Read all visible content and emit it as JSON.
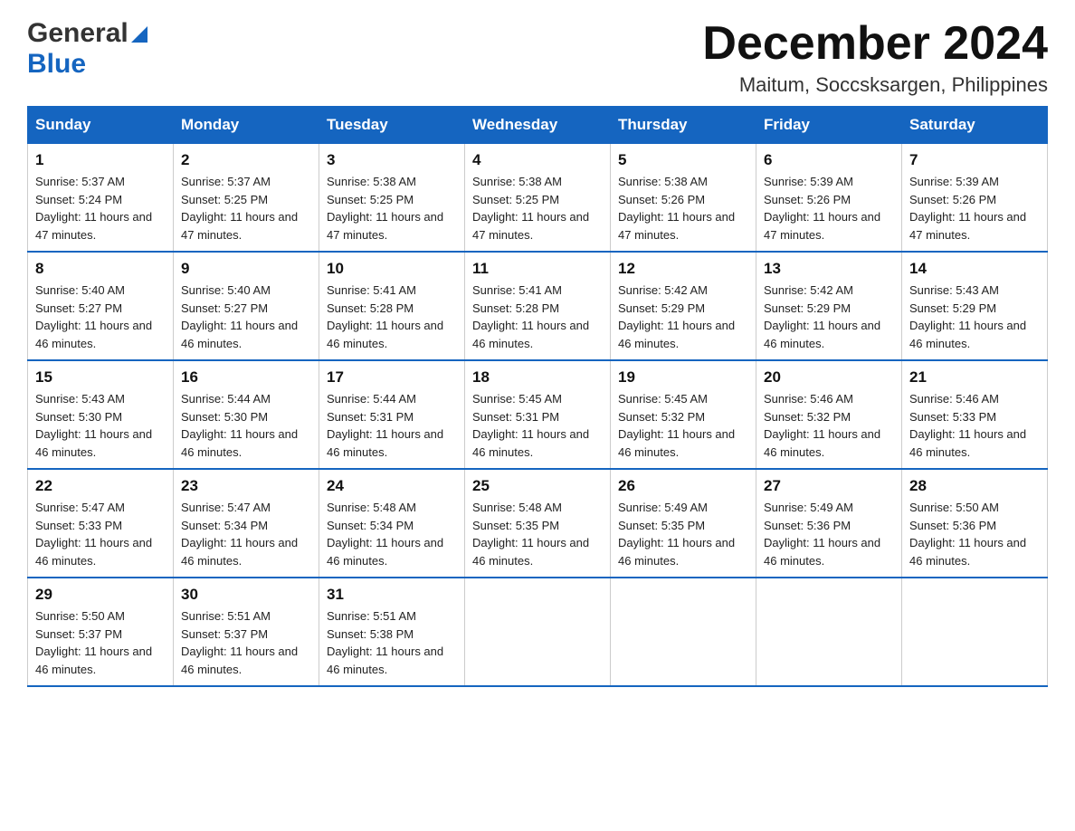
{
  "header": {
    "month_year": "December 2024",
    "location": "Maitum, Soccsksargen, Philippines"
  },
  "logo": {
    "general": "General",
    "blue": "Blue"
  },
  "days_of_week": [
    "Sunday",
    "Monday",
    "Tuesday",
    "Wednesday",
    "Thursday",
    "Friday",
    "Saturday"
  ],
  "weeks": [
    [
      {
        "day": "1",
        "sunrise": "5:37 AM",
        "sunset": "5:24 PM",
        "daylight": "11 hours and 47 minutes."
      },
      {
        "day": "2",
        "sunrise": "5:37 AM",
        "sunset": "5:25 PM",
        "daylight": "11 hours and 47 minutes."
      },
      {
        "day": "3",
        "sunrise": "5:38 AM",
        "sunset": "5:25 PM",
        "daylight": "11 hours and 47 minutes."
      },
      {
        "day": "4",
        "sunrise": "5:38 AM",
        "sunset": "5:25 PM",
        "daylight": "11 hours and 47 minutes."
      },
      {
        "day": "5",
        "sunrise": "5:38 AM",
        "sunset": "5:26 PM",
        "daylight": "11 hours and 47 minutes."
      },
      {
        "day": "6",
        "sunrise": "5:39 AM",
        "sunset": "5:26 PM",
        "daylight": "11 hours and 47 minutes."
      },
      {
        "day": "7",
        "sunrise": "5:39 AM",
        "sunset": "5:26 PM",
        "daylight": "11 hours and 47 minutes."
      }
    ],
    [
      {
        "day": "8",
        "sunrise": "5:40 AM",
        "sunset": "5:27 PM",
        "daylight": "11 hours and 46 minutes."
      },
      {
        "day": "9",
        "sunrise": "5:40 AM",
        "sunset": "5:27 PM",
        "daylight": "11 hours and 46 minutes."
      },
      {
        "day": "10",
        "sunrise": "5:41 AM",
        "sunset": "5:28 PM",
        "daylight": "11 hours and 46 minutes."
      },
      {
        "day": "11",
        "sunrise": "5:41 AM",
        "sunset": "5:28 PM",
        "daylight": "11 hours and 46 minutes."
      },
      {
        "day": "12",
        "sunrise": "5:42 AM",
        "sunset": "5:29 PM",
        "daylight": "11 hours and 46 minutes."
      },
      {
        "day": "13",
        "sunrise": "5:42 AM",
        "sunset": "5:29 PM",
        "daylight": "11 hours and 46 minutes."
      },
      {
        "day": "14",
        "sunrise": "5:43 AM",
        "sunset": "5:29 PM",
        "daylight": "11 hours and 46 minutes."
      }
    ],
    [
      {
        "day": "15",
        "sunrise": "5:43 AM",
        "sunset": "5:30 PM",
        "daylight": "11 hours and 46 minutes."
      },
      {
        "day": "16",
        "sunrise": "5:44 AM",
        "sunset": "5:30 PM",
        "daylight": "11 hours and 46 minutes."
      },
      {
        "day": "17",
        "sunrise": "5:44 AM",
        "sunset": "5:31 PM",
        "daylight": "11 hours and 46 minutes."
      },
      {
        "day": "18",
        "sunrise": "5:45 AM",
        "sunset": "5:31 PM",
        "daylight": "11 hours and 46 minutes."
      },
      {
        "day": "19",
        "sunrise": "5:45 AM",
        "sunset": "5:32 PM",
        "daylight": "11 hours and 46 minutes."
      },
      {
        "day": "20",
        "sunrise": "5:46 AM",
        "sunset": "5:32 PM",
        "daylight": "11 hours and 46 minutes."
      },
      {
        "day": "21",
        "sunrise": "5:46 AM",
        "sunset": "5:33 PM",
        "daylight": "11 hours and 46 minutes."
      }
    ],
    [
      {
        "day": "22",
        "sunrise": "5:47 AM",
        "sunset": "5:33 PM",
        "daylight": "11 hours and 46 minutes."
      },
      {
        "day": "23",
        "sunrise": "5:47 AM",
        "sunset": "5:34 PM",
        "daylight": "11 hours and 46 minutes."
      },
      {
        "day": "24",
        "sunrise": "5:48 AM",
        "sunset": "5:34 PM",
        "daylight": "11 hours and 46 minutes."
      },
      {
        "day": "25",
        "sunrise": "5:48 AM",
        "sunset": "5:35 PM",
        "daylight": "11 hours and 46 minutes."
      },
      {
        "day": "26",
        "sunrise": "5:49 AM",
        "sunset": "5:35 PM",
        "daylight": "11 hours and 46 minutes."
      },
      {
        "day": "27",
        "sunrise": "5:49 AM",
        "sunset": "5:36 PM",
        "daylight": "11 hours and 46 minutes."
      },
      {
        "day": "28",
        "sunrise": "5:50 AM",
        "sunset": "5:36 PM",
        "daylight": "11 hours and 46 minutes."
      }
    ],
    [
      {
        "day": "29",
        "sunrise": "5:50 AM",
        "sunset": "5:37 PM",
        "daylight": "11 hours and 46 minutes."
      },
      {
        "day": "30",
        "sunrise": "5:51 AM",
        "sunset": "5:37 PM",
        "daylight": "11 hours and 46 minutes."
      },
      {
        "day": "31",
        "sunrise": "5:51 AM",
        "sunset": "5:38 PM",
        "daylight": "11 hours and 46 minutes."
      },
      null,
      null,
      null,
      null
    ]
  ]
}
